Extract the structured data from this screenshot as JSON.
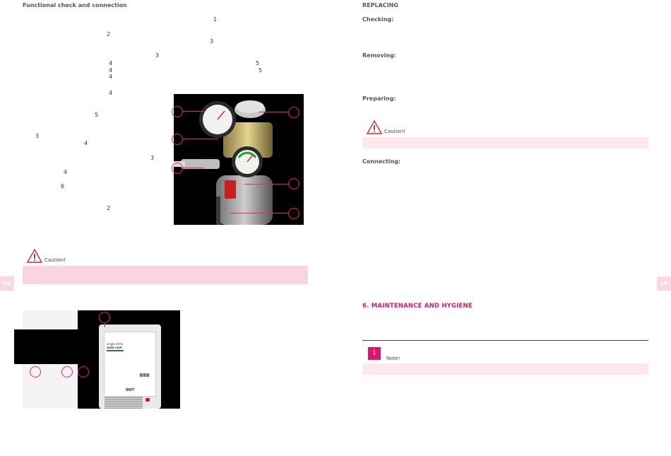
{
  "left": {
    "heading": "Functional check and connection",
    "refs": [
      "1",
      "2",
      "3",
      "3",
      "4",
      "5",
      "4",
      "5",
      "4",
      "4",
      "5",
      "3",
      "4",
      "3",
      "4",
      "6",
      "2"
    ],
    "caution_label": "Caution!",
    "en_tab": "EN"
  },
  "right": {
    "heading": "REPLACING",
    "checking": "Checking:",
    "removing": "Removing:",
    "preparing": "Preparing:",
    "caution_label": "Caution!",
    "connecting": "Connecting:",
    "section_title": "6.  MAINTENANCE AND HYGIENE",
    "note_label": "Note!",
    "note_icon": "i",
    "en_tab": "EN"
  },
  "device_label": {
    "line1": "single drink",
    "line2": "soda cool",
    "brand": "BWT"
  },
  "colors": {
    "accent": "#d9176e",
    "callout": "#e8206f",
    "pink_band": "#fde8ee"
  }
}
